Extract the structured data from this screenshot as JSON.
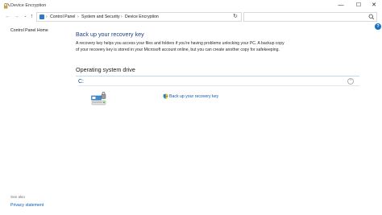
{
  "window": {
    "title": "Device Encryption",
    "minimize_glyph": "—",
    "maximize_glyph": "☐",
    "close_glyph": "✕"
  },
  "nav": {
    "back_glyph": "←",
    "forward_glyph": "→",
    "recent_glyph": "⌄",
    "up_glyph": "↑",
    "refresh_glyph": "↻",
    "dropdown_glyph": "⌄",
    "separator_glyph": "›"
  },
  "breadcrumb": {
    "items": [
      "Control Panel",
      "System and Security",
      "Device Encryption"
    ]
  },
  "search": {
    "placeholder": "",
    "icon": "search-icon"
  },
  "sidebar": {
    "home_label": "Control Panel Home",
    "see_also_label": "See also",
    "privacy_label": "Privacy statement"
  },
  "help": {
    "glyph": "?"
  },
  "main": {
    "title": "Back up your recovery key",
    "description": "A recovery key helps you access your files and folders if you're having problems unlocking your PC. A backup copy of your recovery key is stored in your Microsoft account online, but you can create another copy for safekeeping.",
    "section_heading": "Operating system drive",
    "drive_label": "C:",
    "collapse_glyph": "⌃",
    "backup_link": "Back up your recovery key"
  },
  "colors": {
    "link": "#0b59b3",
    "heading_blue": "#1e3e8b",
    "drive_blue": "#1a4fa3"
  }
}
